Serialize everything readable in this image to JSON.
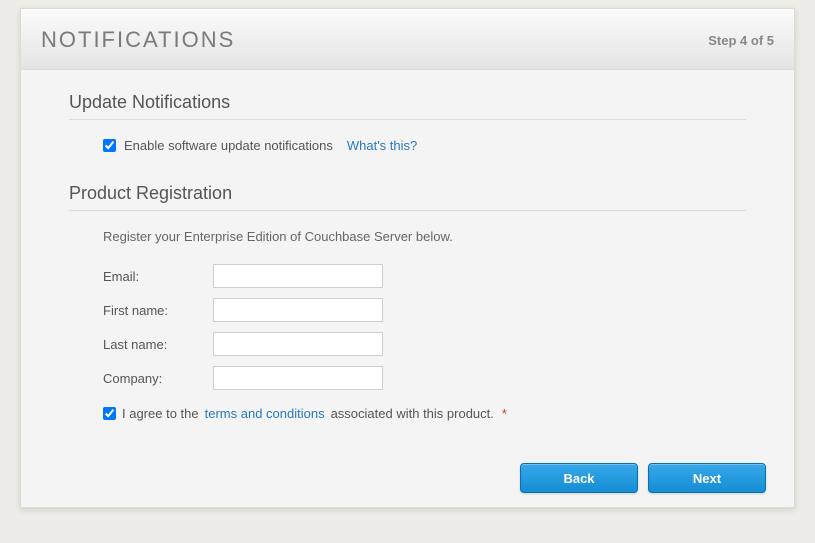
{
  "header": {
    "title": "NOTIFICATIONS",
    "step": "Step 4 of 5"
  },
  "sections": {
    "update": {
      "title": "Update Notifications",
      "enable_label": "Enable software update notifications",
      "whats_this": "What's this?"
    },
    "registration": {
      "title": "Product Registration",
      "description": "Register your Enterprise Edition of Couchbase Server below.",
      "fields": {
        "email": "Email:",
        "first_name": "First name:",
        "last_name": "Last name:",
        "company": "Company:"
      },
      "agree_prefix": "I agree to the ",
      "terms_link": "terms and conditions",
      "agree_suffix": " associated with this product.",
      "required": "*"
    }
  },
  "footer": {
    "back": "Back",
    "next": "Next"
  }
}
